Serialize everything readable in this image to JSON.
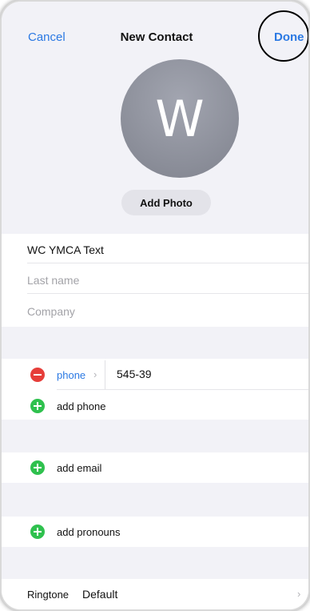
{
  "nav": {
    "cancel": "Cancel",
    "title": "New Contact",
    "done": "Done"
  },
  "avatar": {
    "letter": "W",
    "add_photo": "Add Photo"
  },
  "name_fields": {
    "first_name": "WC YMCA Text",
    "last_name_placeholder": "Last name",
    "company_placeholder": "Company"
  },
  "phone": {
    "label": "phone",
    "chevron": "›",
    "value": "545-39",
    "add_label": "add phone"
  },
  "email": {
    "add_label": "add email"
  },
  "pronouns": {
    "add_label": "add pronouns"
  },
  "ringtone": {
    "label": "Ringtone",
    "value": "Default",
    "chevron": "›"
  },
  "colors": {
    "accent": "#2b79e3",
    "remove": "#e63e3a",
    "add": "#2fc14e",
    "group_bg": "#f2f2f7"
  }
}
